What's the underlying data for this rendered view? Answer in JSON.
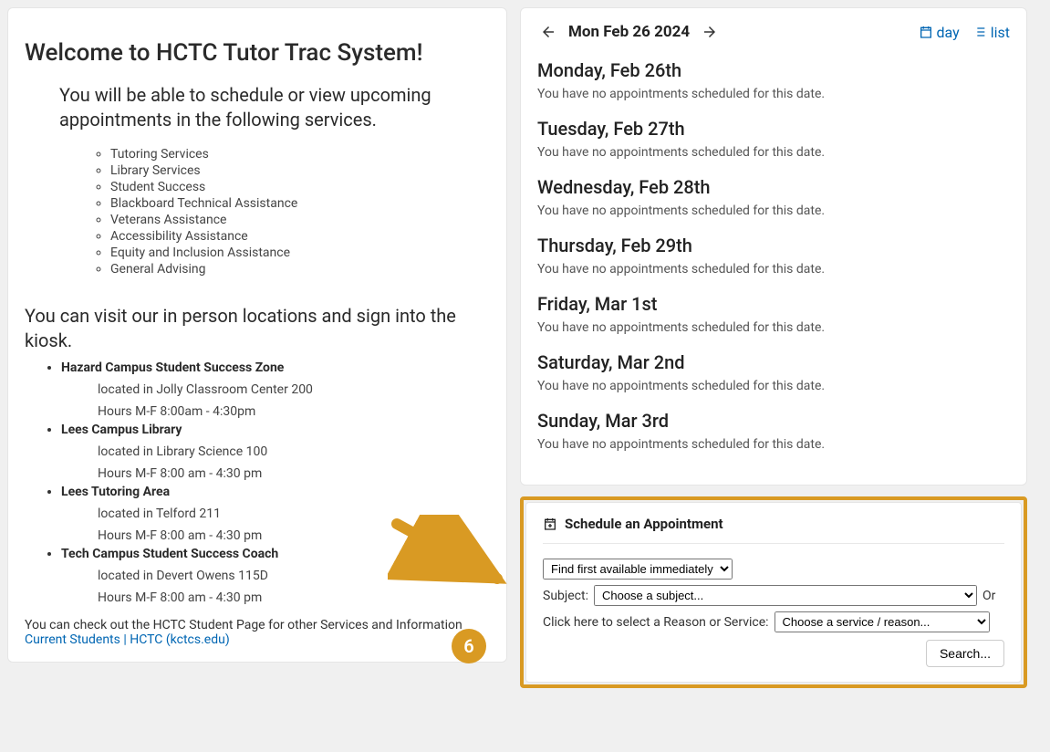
{
  "welcome": {
    "title": "Welcome to HCTC Tutor Trac System!",
    "intro": "You will be able to schedule or view upcoming appointments in the following services.",
    "services": [
      "Tutoring Services",
      "Library Services",
      "Student Success",
      "Blackboard Technical Assistance",
      "Veterans Assistance",
      "Accessibility Assistance",
      "Equity and Inclusion Assistance",
      "General Advising"
    ],
    "visit_heading": "You can visit our in person locations and sign into the kiosk.",
    "locations": [
      {
        "name": "Hazard Campus Student Success Zone",
        "located": "located in Jolly Classroom Center 200",
        "hours": "Hours M-F 8:00am - 4:30pm"
      },
      {
        "name": "Lees Campus Library",
        "located": "located in Library Science 100",
        "hours": " Hours M-F 8:00 am - 4:30 pm"
      },
      {
        "name": "Lees Tutoring Area",
        "located": "located in Telford 211",
        "hours": "Hours M-F 8:00 am - 4:30 pm"
      },
      {
        "name": "Tech Campus Student Success Coach",
        "located": "located in Devert Owens 115D",
        "hours": "Hours M-F 8:00 am - 4:30 pm"
      }
    ],
    "footer_text": "You can check out the HCTC Student Page for other Services and Information",
    "footer_link": "Current Students | HCTC (kctcs.edu)"
  },
  "calendar": {
    "current_date": "Mon Feb 26 2024",
    "view_day": "day",
    "view_list": "list",
    "no_appt_msg": "You have no appointments scheduled for this date.",
    "days": [
      "Monday, Feb 26th",
      "Tuesday, Feb 27th",
      "Wednesday, Feb 28th",
      "Thursday, Feb 29th",
      "Friday, Mar 1st",
      "Saturday, Mar 2nd",
      "Sunday, Mar 3rd"
    ]
  },
  "schedule": {
    "title": "Schedule an Appointment",
    "find_option": "Find first available immediately",
    "subject_label": "Subject:",
    "subject_placeholder": "Choose a subject...",
    "or": "Or",
    "reason_label": "Click here to select a Reason or Service:",
    "service_placeholder": "Choose a service / reason...",
    "search_btn": "Search..."
  },
  "badge": "6"
}
